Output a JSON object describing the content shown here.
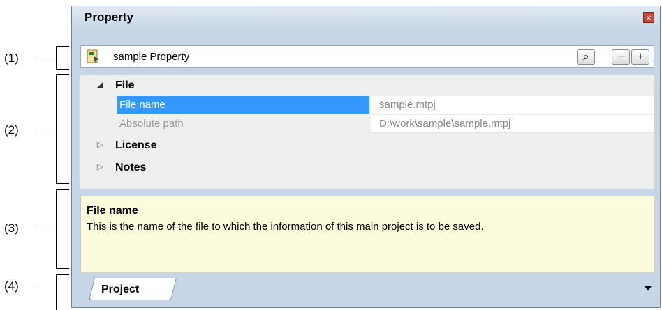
{
  "callouts": [
    "(1)",
    "(2)",
    "(3)",
    "(4)"
  ],
  "panel": {
    "title": "Property",
    "close_icon": "×"
  },
  "toolbar": {
    "icon": "project-icon",
    "label": "sample Property",
    "search_label": "⌕",
    "collapse_label": "−",
    "expand_label": "+"
  },
  "grid": {
    "categories": [
      {
        "label": "File",
        "expanded": true
      },
      {
        "label": "License",
        "expanded": false
      },
      {
        "label": "Notes",
        "expanded": false
      }
    ],
    "properties": [
      {
        "name": "File name",
        "value": "sample.mtpj",
        "selected": true
      },
      {
        "name": "Absolute path",
        "value": "D:\\work\\sample\\sample.mtpj",
        "selected": false
      }
    ]
  },
  "description": {
    "title": "File name",
    "text": "This is the name of the file to which the information of this main project is to be saved."
  },
  "tabs": [
    {
      "label": "Project"
    }
  ],
  "colors": {
    "selection": "#3399ff",
    "description_bg": "#fcfbdc",
    "panel_bg": "#c7d6e6"
  }
}
